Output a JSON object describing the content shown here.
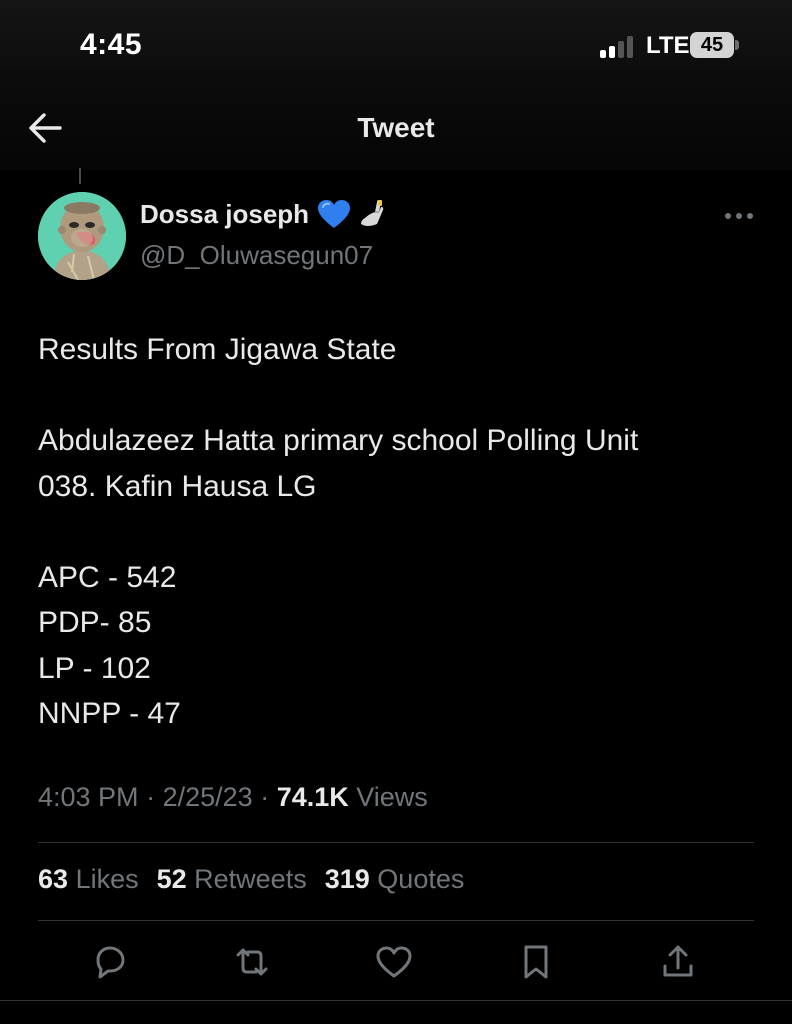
{
  "status_bar": {
    "time": "4:45",
    "network": "LTE",
    "battery": "45"
  },
  "nav": {
    "title": "Tweet",
    "back_icon": "back-arrow-icon"
  },
  "author": {
    "name": "Dossa joseph",
    "handle": "@D_Oluwasegun07",
    "badges": [
      "blue-heart-icon",
      "hand-emoji-icon"
    ],
    "avatar": "ape-avatar"
  },
  "tweet": {
    "lines": [
      "Results From Jigawa State",
      "",
      "Abdulazeez Hatta primary school Polling Unit",
      "038. Kafin Hausa LG",
      "",
      "APC - 542",
      "PDP- 85",
      "LP - 102",
      "NNPP - 47"
    ]
  },
  "meta": {
    "time": "4:03 PM",
    "date": "2/25/23",
    "views_count": "74.1K",
    "views_label": "Views"
  },
  "stats": {
    "likes_count": "63",
    "likes_label": "Likes",
    "retweets_count": "52",
    "retweets_label": "Retweets",
    "quotes_count": "319",
    "quotes_label": "Quotes"
  },
  "actions": [
    "reply-icon",
    "retweet-icon",
    "like-icon",
    "bookmark-icon",
    "share-icon"
  ],
  "colors": {
    "background": "#000000",
    "text": "#e7e9ea",
    "secondary": "#71767b",
    "divider": "#2f3336",
    "avatar_bg": "#5fd0b0"
  }
}
